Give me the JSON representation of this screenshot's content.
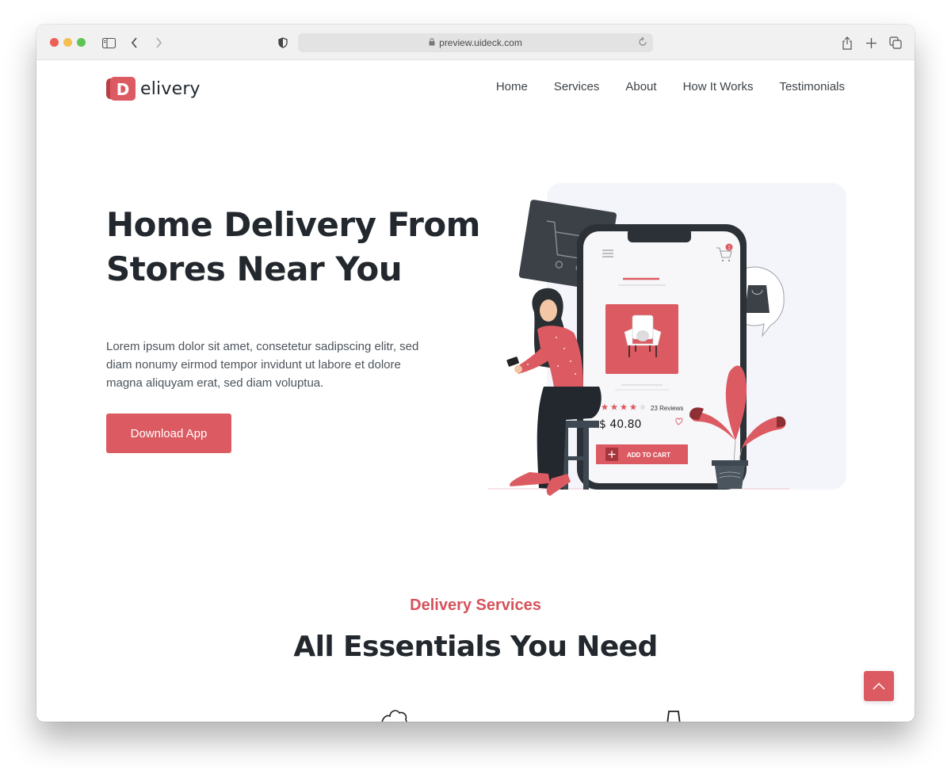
{
  "browser": {
    "url": "preview.uideck.com",
    "icons": [
      "sidebar-toggle-icon",
      "back-icon",
      "forward-icon",
      "shield-icon",
      "lock-icon",
      "reload-icon",
      "share-icon",
      "new-tab-icon",
      "tabs-overview-icon"
    ]
  },
  "brand": {
    "logo_letter": "D",
    "logo_text": "elivery",
    "accent_color": "#dc5b62",
    "dark_color": "#22282d"
  },
  "nav": {
    "items": [
      {
        "label": "Home"
      },
      {
        "label": "Services"
      },
      {
        "label": "About"
      },
      {
        "label": "How It Works"
      },
      {
        "label": "Testimonials"
      }
    ]
  },
  "hero": {
    "title_bold": "Home Delivery",
    "title_rest_line1": " From",
    "title_line2": "Stores Near You",
    "description": "Lorem ipsum dolor sit amet, consetetur sadipscing elitr, sed diam nonumy eirmod tempor invidunt ut labore et dolore magna aliquyam erat, sed diam voluptua.",
    "cta_label": "Download App"
  },
  "illustration": {
    "cart_badge": "1",
    "rating_stars": 4,
    "rating_max": 5,
    "reviews_label": "23 Reviews",
    "price": "$ 40.80",
    "add_to_cart_label": "ADD TO CART"
  },
  "services": {
    "tag": "Delivery Services",
    "title": "All Essentials You Need"
  },
  "scroll_top": {
    "icon": "chevron-up-icon"
  }
}
